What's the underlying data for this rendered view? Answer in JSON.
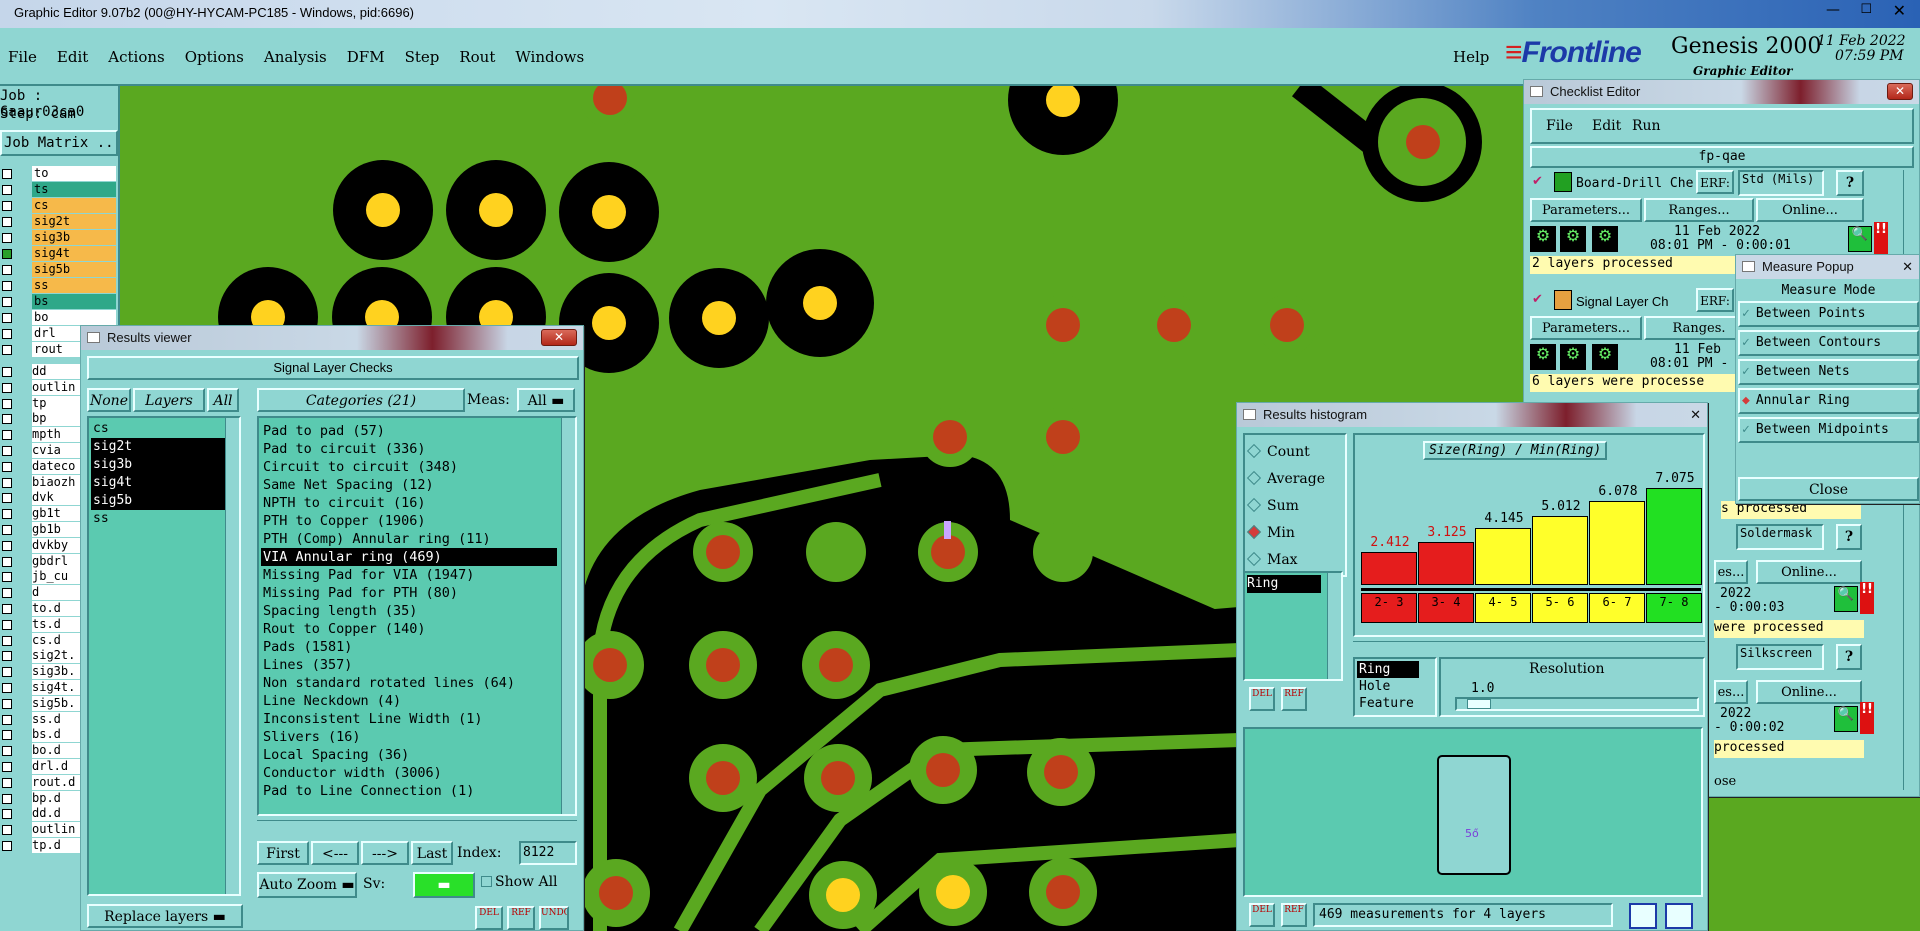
{
  "window_title": "Graphic Editor 9.07b2 (00@HY-HYCAM-PC185 - Windows, pid:6696)",
  "menu": [
    "File",
    "Edit",
    "Actions",
    "Options",
    "Analysis",
    "DFM",
    "Step",
    "Rout",
    "Windows"
  ],
  "help": "Help",
  "brand": {
    "logo": "Frontline",
    "product": "Genesis 2000",
    "subtitle": "Graphic Editor",
    "date": "11 Feb 2022",
    "time": "07:59 PM"
  },
  "job": {
    "job_label": "Job : 6aaur03ca0",
    "step_label": "Step: cam",
    "matrix_button": "Job Matrix ..."
  },
  "layers": [
    {
      "name": "to",
      "color": "#ffffff"
    },
    {
      "name": "ts",
      "color": "#2fa889"
    },
    {
      "name": "cs",
      "color": "#f6b94a"
    },
    {
      "name": "sig2t",
      "color": "#f6b94a"
    },
    {
      "name": "sig3b",
      "color": "#f6b94a"
    },
    {
      "name": "sig4t",
      "color": "#f6b94a"
    },
    {
      "name": "sig5b",
      "color": "#f6b94a"
    },
    {
      "name": "ss",
      "color": "#f6b94a"
    },
    {
      "name": "bs",
      "color": "#2fa889"
    },
    {
      "name": "bo",
      "color": "#ffffff"
    },
    {
      "name": "drl",
      "color": "#ffffff"
    },
    {
      "name": "rout",
      "color": "#ffffff"
    }
  ],
  "layers2": [
    "dd",
    "outlin",
    "tp",
    "bp",
    "mpth",
    "cvia",
    "dateco",
    "biaozh",
    "dvk",
    "gb1t",
    "gb1b",
    "dvkby",
    "gbdrl",
    "jb_cu",
    "d",
    "to.d",
    "ts.d",
    "cs.d",
    "sig2t.",
    "sig3b.",
    "sig4t.",
    "sig5b.",
    "ss.d",
    "bs.d",
    "bo.d",
    "drl.d",
    "rout.d",
    "bp.d",
    "dd.d",
    "outlin",
    "tp.d"
  ],
  "results_viewer": {
    "title": "Results viewer",
    "header": "Signal Layer Checks",
    "none_btn": "None",
    "layers_btn": "Layers",
    "all_btn": "All",
    "categories_label": "Categories (21)",
    "meas_label": "Meas:",
    "meas_value": "All",
    "layer_list": [
      "cs",
      "sig2t",
      "sig3b",
      "sig4t",
      "sig5b",
      "ss"
    ],
    "categories": [
      "Pad to pad (57)",
      "Pad to circuit (336)",
      "Circuit to circuit (348)",
      "Same Net Spacing (12)",
      "NPTH to circuit (16)",
      "PTH to Copper (1906)",
      "PTH (Comp) Annular ring (11)",
      "VIA Annular ring (469)",
      "Missing Pad for VIA (1947)",
      "Missing Pad for PTH (80)",
      "Spacing length (35)",
      "Rout to Copper (140)",
      "Pads (1581)",
      "Lines (357)",
      "Non standard rotated lines (64)",
      "Line Neckdown (4)",
      "Inconsistent Line Width (1)",
      "Slivers (16)",
      "Local Spacing (36)",
      "Conductor width (3006)",
      "Pad to Line Connection (1)"
    ],
    "first_btn": "First",
    "prev_btn": "<---",
    "next_btn": "--->",
    "last_btn": "Last",
    "index_label": "Index:",
    "index_value": "8122",
    "autozoom": "Auto Zoom",
    "sv_label": "Sv:",
    "show_all": "Show All",
    "replace_layers": "Replace layers",
    "del": "DEL",
    "ref": "REF",
    "undo": "UNDO"
  },
  "checklist_editor": {
    "title": "Checklist Editor",
    "menu": [
      "File",
      "Edit",
      "Run"
    ],
    "name": "fp-qae",
    "items": [
      {
        "name": "Board-Drill Che",
        "erf": "ERF:",
        "erf_value": "Std (Mils)",
        "params": "Parameters...",
        "ranges": "Ranges...",
        "online": "Online...",
        "date": "11 Feb 2022",
        "time": "08:01 PM - 0:00:01",
        "status": "2 layers processed"
      },
      {
        "name": "Signal Layer Ch",
        "erf": "ERF:",
        "params": "Parameters...",
        "ranges": "Ranges.",
        "date": "11 Feb",
        "time": "08:01 PM -",
        "status": "6 layers were processe"
      }
    ],
    "lower": [
      {
        "erf_value": "Soldermask",
        "ranges": "es...",
        "online": "Online...",
        "date": "2022",
        "time": "- 0:00:03",
        "status": "were processed"
      },
      {
        "erf_value": "Silkscreen",
        "ranges": "es...",
        "online": "Online...",
        "date": "2022",
        "time": "- 0:00:02",
        "status": "processed"
      }
    ],
    "partial_status": "s processed",
    "close_partial": "ose"
  },
  "measure_popup": {
    "title": "Measure Popup",
    "heading": "Measure Mode",
    "options": [
      "Between Points",
      "Between Contours",
      "Between Nets",
      "Annular Ring",
      "Between Midpoints"
    ],
    "active": "Annular Ring",
    "close": "Close"
  },
  "histogram": {
    "title": "Results histogram",
    "modes": [
      "Count",
      "Average",
      "Sum",
      "Min",
      "Max"
    ],
    "active_mode": "Min",
    "ring_label": "Ring",
    "chart_title": "Size(Ring) / Min(Ring)",
    "bars": [
      {
        "value": "2.412",
        "range": "2- 3",
        "color": "#e51d1d"
      },
      {
        "value": "3.125",
        "range": "3- 4",
        "color": "#e51d1d"
      },
      {
        "value": "4.145",
        "range": "4- 5",
        "color": "#ffff2a"
      },
      {
        "value": "5.012",
        "range": "5- 6",
        "color": "#ffff2a"
      },
      {
        "value": "6.078",
        "range": "6- 7",
        "color": "#ffff2a"
      },
      {
        "value": "7.075",
        "range": "7- 8",
        "color": "#22e022"
      }
    ],
    "kinds": [
      "Ring",
      "Hole",
      "Feature"
    ],
    "resolution_label": "Resolution",
    "resolution_value": "1.0",
    "preview_label": "5ő",
    "footer": "469 measurements for 4 layers",
    "del": "DEL",
    "ref": "REF"
  }
}
